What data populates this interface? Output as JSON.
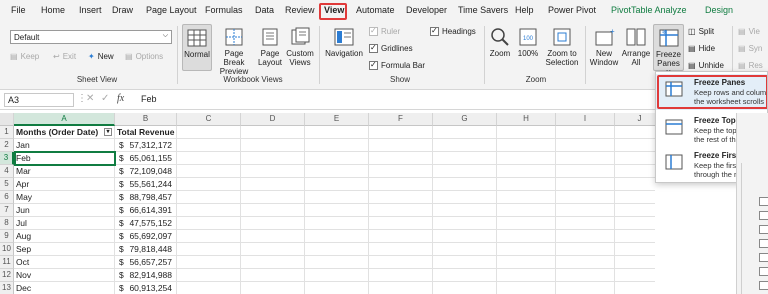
{
  "tabs": [
    "File",
    "Home",
    "Insert",
    "Draw",
    "Page Layout",
    "Formulas",
    "Data",
    "Review",
    "View",
    "Automate",
    "Developer",
    "Time Savers",
    "Help",
    "Power Pivot",
    "PivotTable Analyze",
    "Design"
  ],
  "active_tab": "View",
  "ribbon": {
    "sheet_view": {
      "dropdown_value": "Default",
      "keep": "Keep",
      "exit": "Exit",
      "new": "New",
      "options": "Options",
      "label": "Sheet View"
    },
    "workbook_views": {
      "normal": "Normal",
      "page_break_preview": [
        "Page Break",
        "Preview"
      ],
      "page_layout": [
        "Page",
        "Layout"
      ],
      "custom_views": [
        "Custom",
        "Views"
      ],
      "label": "Workbook Views"
    },
    "show": {
      "navigation": "Navigation",
      "ruler": "Ruler",
      "gridlines": "Gridlines",
      "formula_bar": "Formula Bar",
      "headings": "Headings",
      "label": "Show"
    },
    "zoom": {
      "zoom": "Zoom",
      "hundred": "100%",
      "zoom_to_selection": [
        "Zoom to",
        "Selection"
      ],
      "label": "Zoom"
    },
    "window": {
      "new_window": [
        "New",
        "Window"
      ],
      "arrange_all": [
        "Arrange",
        "All"
      ],
      "freeze_panes": [
        "Freeze",
        "Panes ˅"
      ],
      "split": "Split",
      "hide": "Hide",
      "unhide": "Unhide",
      "view_side": "Vie",
      "sync": "Syn",
      "reset": "Res"
    }
  },
  "formula_bar": {
    "name_box": "A3",
    "fx": "fx",
    "value": "Feb"
  },
  "sheet": {
    "columns": [
      "A",
      "B",
      "C",
      "D",
      "E",
      "F",
      "G",
      "H",
      "I",
      "J"
    ],
    "row_numbers": [
      "1",
      "2",
      "3",
      "4",
      "5",
      "6",
      "7",
      "8",
      "9",
      "10",
      "11",
      "12",
      "13"
    ],
    "header": [
      "Months (Order Date)",
      "Total Revenue"
    ],
    "currency": "$",
    "rows": [
      {
        "month": "Jan",
        "revenue": "57,312,172"
      },
      {
        "month": "Feb",
        "revenue": "65,061,155"
      },
      {
        "month": "Mar",
        "revenue": "72,109,048"
      },
      {
        "month": "Apr",
        "revenue": "55,561,244"
      },
      {
        "month": "May",
        "revenue": "88,798,457"
      },
      {
        "month": "Jun",
        "revenue": "66,614,391"
      },
      {
        "month": "Jul",
        "revenue": "47,575,152"
      },
      {
        "month": "Aug",
        "revenue": "65,692,097"
      },
      {
        "month": "Sep",
        "revenue": "79,818,448"
      },
      {
        "month": "Oct",
        "revenue": "56,657,257"
      },
      {
        "month": "Nov",
        "revenue": "82,914,988"
      },
      {
        "month": "Dec",
        "revenue": "60,913,254"
      }
    ]
  },
  "freeze_menu": [
    {
      "title": "Freeze Panes",
      "desc": [
        "Keep rows and colum",
        "the worksheet scrolls"
      ]
    },
    {
      "title": "Freeze Top Row",
      "desc": [
        "Keep the top row visib",
        "the rest of the worksh"
      ]
    },
    {
      "title": "Freeze First Column",
      "desc": [
        "Keep the first column",
        "through the rest of the"
      ]
    }
  ],
  "colors": {
    "excel_green": "#107c41",
    "highlight_red": "#e03a3a",
    "freeze_blue": "#2b7cd3"
  }
}
